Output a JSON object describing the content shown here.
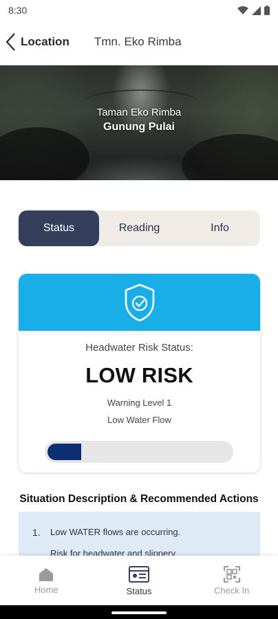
{
  "status_bar": {
    "time": "8:30",
    "icons": [
      "wifi-icon",
      "signal-icon",
      "battery-icon"
    ]
  },
  "app_bar": {
    "back_label": "Location",
    "place_name": "Tmn. Eko Rimba"
  },
  "hero": {
    "subtitle": "Taman Eko Rimba",
    "title": "Gunung Pulai"
  },
  "tabs": [
    {
      "label": "Status",
      "active": true
    },
    {
      "label": "Reading",
      "active": false
    },
    {
      "label": "Info",
      "active": false
    }
  ],
  "risk_card": {
    "header_color": "#1aaee9",
    "icon": "shield-check-icon",
    "caption": "Headwater Risk Status:",
    "risk_level": "LOW RISK",
    "warning_level": "Warning Level 1",
    "flow": "Low Water Flow",
    "progress_fraction": 0.18,
    "progress_color": "#0c2f73"
  },
  "actions": {
    "title": "Situation Description & Recommended Actions",
    "items": [
      {
        "number": "1.",
        "text": "Low WATER flows are occurring.",
        "text2": "Risk for headwater and slippery"
      }
    ]
  },
  "bottom_nav": [
    {
      "label": "Home",
      "icon": "home-icon",
      "active": false
    },
    {
      "label": "Status",
      "icon": "status-card-icon",
      "active": true
    },
    {
      "label": "Check In",
      "icon": "qr-code-icon",
      "active": false
    }
  ],
  "colors": {
    "primary": "#34405b",
    "tab_bg": "#f1ebe8",
    "actions_bg": "#deebf6"
  }
}
